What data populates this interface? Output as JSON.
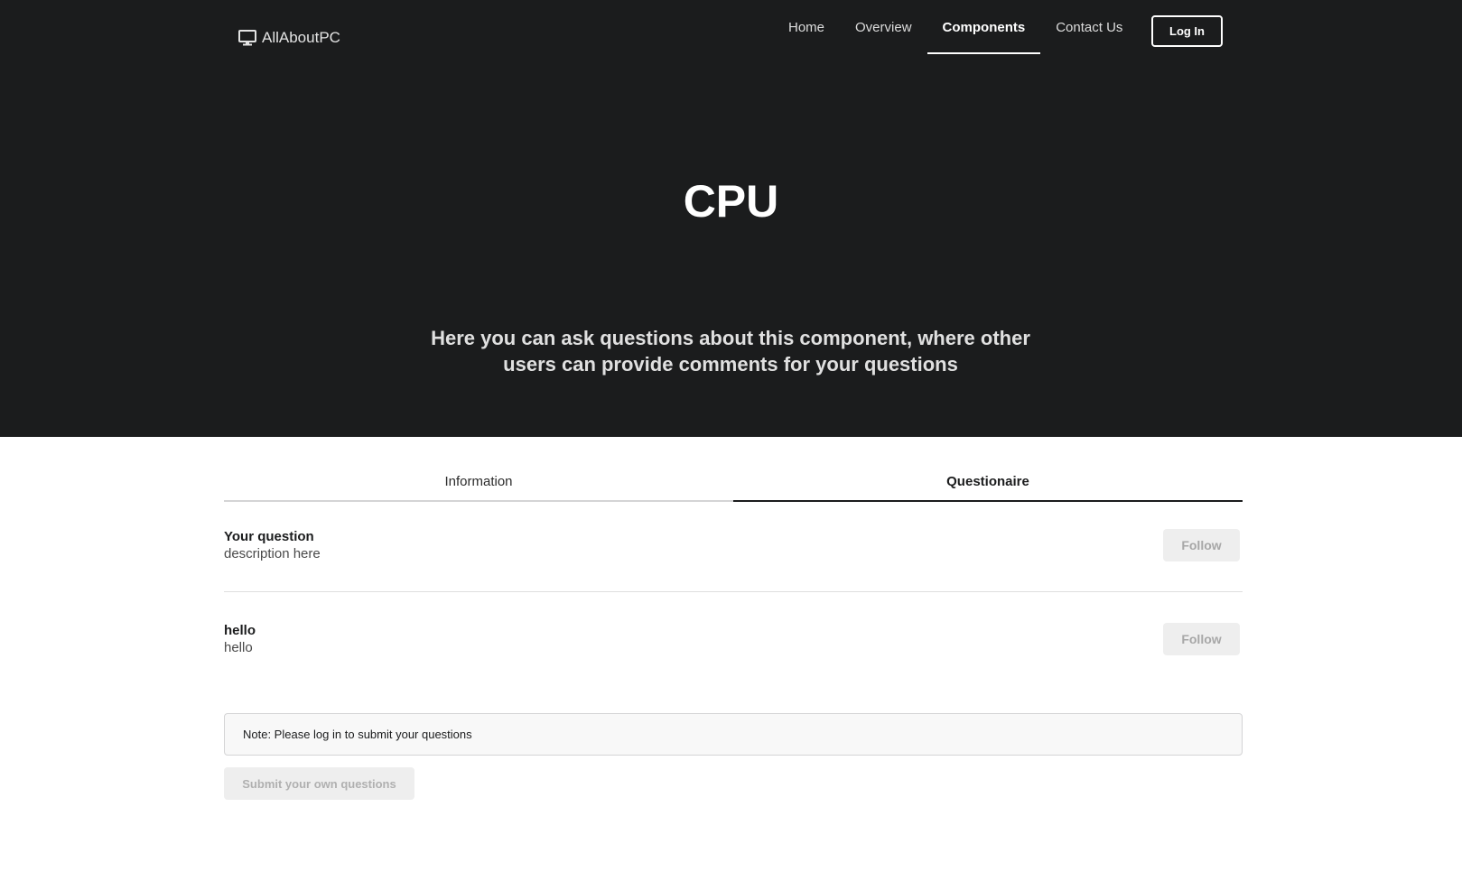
{
  "brand": {
    "name": "AllAboutPC",
    "icon": "desktop-monitor-icon"
  },
  "nav": {
    "items": [
      {
        "label": "Home",
        "active": false
      },
      {
        "label": "Overview",
        "active": false
      },
      {
        "label": "Components",
        "active": true
      },
      {
        "label": "Contact Us",
        "active": false
      }
    ],
    "login_label": "Log In"
  },
  "hero": {
    "title": "CPU",
    "subtitle": "Here you can ask questions about this component, where other users can provide comments for your questions"
  },
  "tabs": [
    {
      "label": "Information",
      "active": false
    },
    {
      "label": "Questionaire",
      "active": true
    }
  ],
  "questions": [
    {
      "title": "Your question",
      "description": "description here",
      "follow_label": "Follow"
    },
    {
      "title": "hello",
      "description": "hello",
      "follow_label": "Follow"
    }
  ],
  "note": "Note: Please log in to submit your questions",
  "submit_label": "Submit your own questions",
  "colors": {
    "hero_background": "#1b1c1d",
    "text_primary": "#1b1c1d",
    "button_disabled": "#eeeeee"
  }
}
